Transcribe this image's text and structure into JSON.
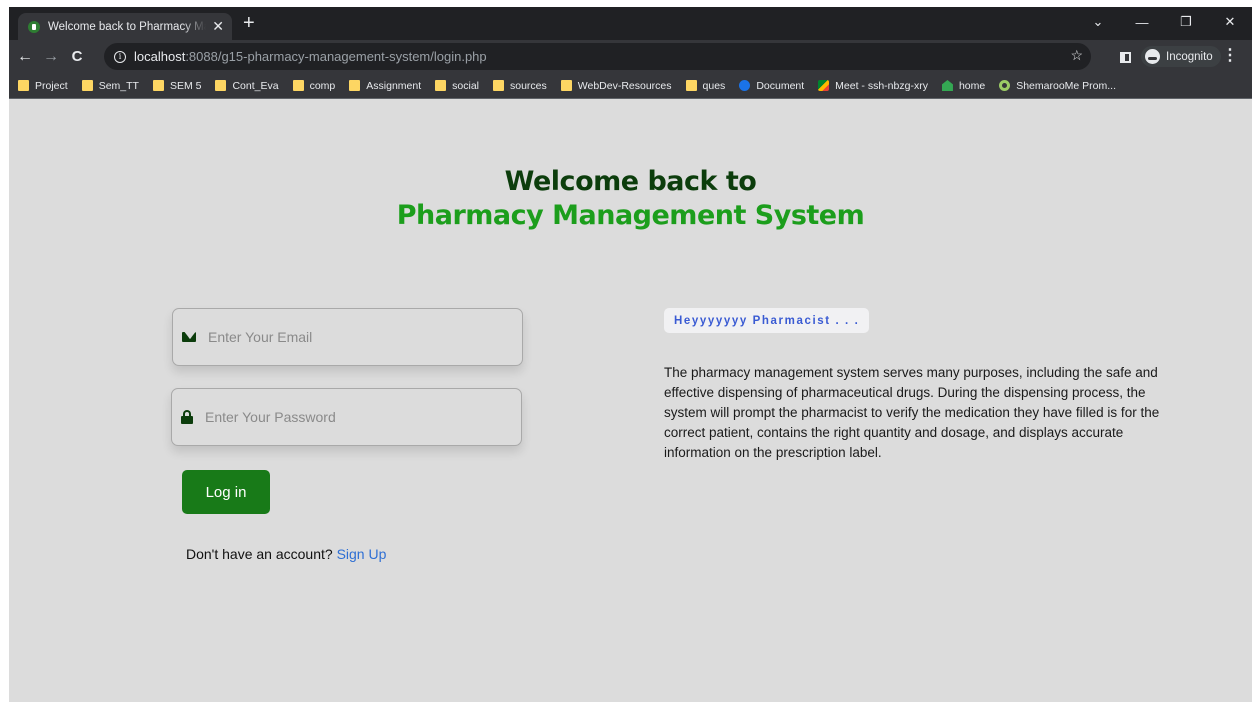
{
  "browser": {
    "tab_title": "Welcome back to Pharmacy Management System",
    "new_tab_glyph": "+",
    "url_host": "localhost",
    "url_rest": ":8088/g15-pharmacy-management-system/login.php",
    "incognito_label": "Incognito",
    "bookmarks": [
      {
        "label": "Project",
        "icon": "folder-icon"
      },
      {
        "label": "Sem_TT",
        "icon": "folder-icon"
      },
      {
        "label": "SEM 5",
        "icon": "folder-icon"
      },
      {
        "label": "Cont_Eva",
        "icon": "folder-icon"
      },
      {
        "label": "comp",
        "icon": "folder-icon"
      },
      {
        "label": "Assignment",
        "icon": "folder-icon"
      },
      {
        "label": "social",
        "icon": "folder-icon"
      },
      {
        "label": "sources",
        "icon": "folder-icon"
      },
      {
        "label": "WebDev-Resources",
        "icon": "folder-icon"
      },
      {
        "label": "ques",
        "icon": "folder-icon"
      },
      {
        "label": "Document",
        "icon": "document-icon"
      },
      {
        "label": "Meet - ssh-nbzg-xry",
        "icon": "meet-icon"
      },
      {
        "label": "home",
        "icon": "home-icon"
      },
      {
        "label": "ShemarooMe Prom...",
        "icon": "shemaroo-icon"
      }
    ]
  },
  "page": {
    "heading_line1": "Welcome back to",
    "heading_line2": "Pharmacy Management System",
    "email_placeholder": "Enter Your Email",
    "password_placeholder": "Enter Your Password",
    "login_label": "Log in",
    "signup_prompt": "Don't have an account? ",
    "signup_link": "Sign Up",
    "greeting": "Heyyyyyyy Pharmacist . . .",
    "description": "The pharmacy management system serves many purposes, including the safe and effective dispensing of pharmaceutical drugs. During the dispensing process, the system will prompt the pharmacist to verify the medication they have filled is for the correct patient, contains the right quantity and dosage, and displays accurate information on the prescription label."
  },
  "colors": {
    "heading_dark": "#0c3d0c",
    "heading_green": "#1c9e1c",
    "button_green": "#187a18",
    "link_blue": "#2e6fd4",
    "page_background": "#dcdcdc"
  }
}
